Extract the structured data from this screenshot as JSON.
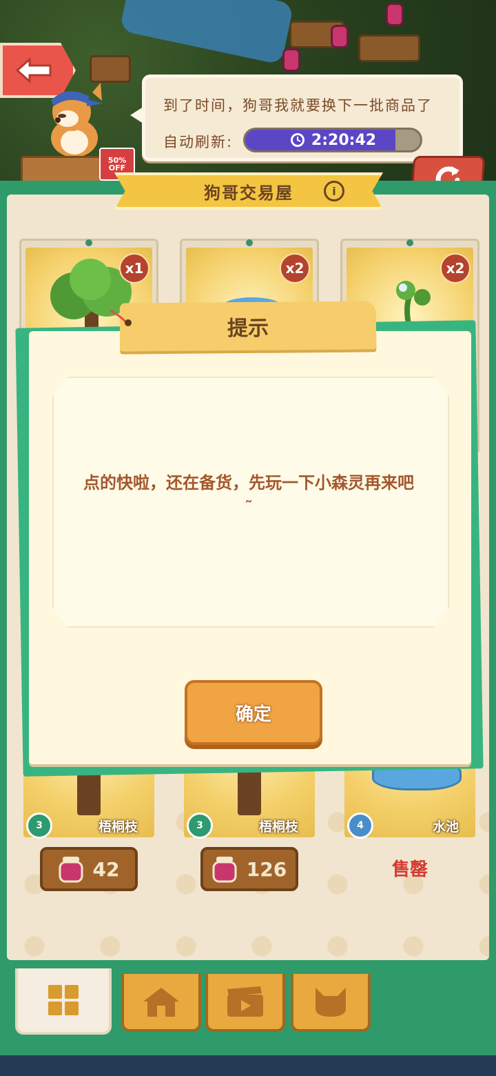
{
  "header": {
    "speech_line": "到了时间，狗哥我就要换下一批商品了",
    "refresh_label": "自动刷新:",
    "timer": "2:20:42",
    "timer_progress": 0.86,
    "sale_tag": "50% OFF"
  },
  "shop": {
    "title": "狗哥交易屋",
    "top_cards": [
      {
        "qty": "x1",
        "item": "tree"
      },
      {
        "qty": "x2",
        "item": "water"
      },
      {
        "qty": "x2",
        "item": "sprout"
      }
    ],
    "bottom_cards": [
      {
        "level": "3",
        "name": "梧桐枝",
        "price": "42",
        "status": "available",
        "item": "tree"
      },
      {
        "level": "3",
        "name": "梧桐枝",
        "price": "126",
        "status": "available",
        "item": "tree"
      },
      {
        "level": "4",
        "name": "水池",
        "price": "",
        "status": "sold",
        "sold_label": "售罄",
        "item": "water"
      }
    ]
  },
  "dialog": {
    "title": "提示",
    "message": "点的快啦，还在备货，先玩一下小森灵再来吧˜",
    "confirm_label": "确定"
  },
  "tabs": [
    {
      "icon": "grid-icon",
      "active": true
    },
    {
      "icon": "house-icon",
      "active": false
    },
    {
      "icon": "video-icon",
      "active": false
    },
    {
      "icon": "cat-icon",
      "active": false
    }
  ],
  "colors": {
    "board_green": "#2f9b6b",
    "timer_fill": "#5b46c6",
    "dialog_bg": "#fff8df",
    "confirm": "#f0a444",
    "sold_red": "#d43a30"
  }
}
